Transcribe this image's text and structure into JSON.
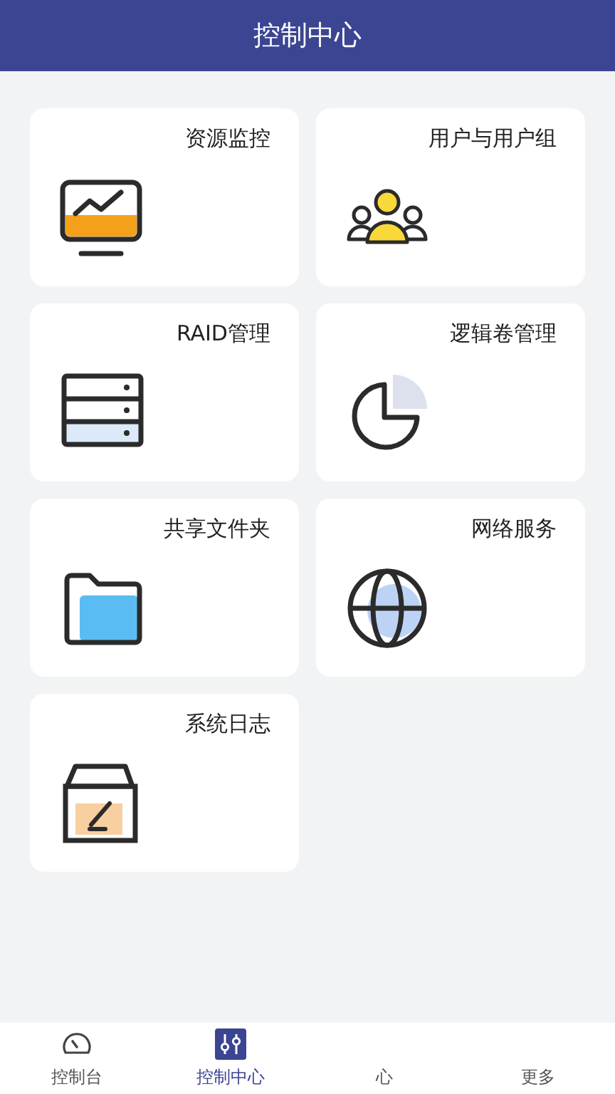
{
  "header": {
    "title": "控制中心"
  },
  "cards": [
    {
      "title": "资源监控"
    },
    {
      "title": "用户与用户组"
    },
    {
      "title": "RAID管理"
    },
    {
      "title": "逻辑卷管理"
    },
    {
      "title": "共享文件夹"
    },
    {
      "title": "网络服务"
    },
    {
      "title": "系统日志"
    }
  ],
  "tabs": [
    {
      "label": "控制台",
      "selected": false
    },
    {
      "label": "控制中心",
      "selected": true
    },
    {
      "label": "心",
      "selected": false
    },
    {
      "label": "更多",
      "selected": false
    }
  ]
}
